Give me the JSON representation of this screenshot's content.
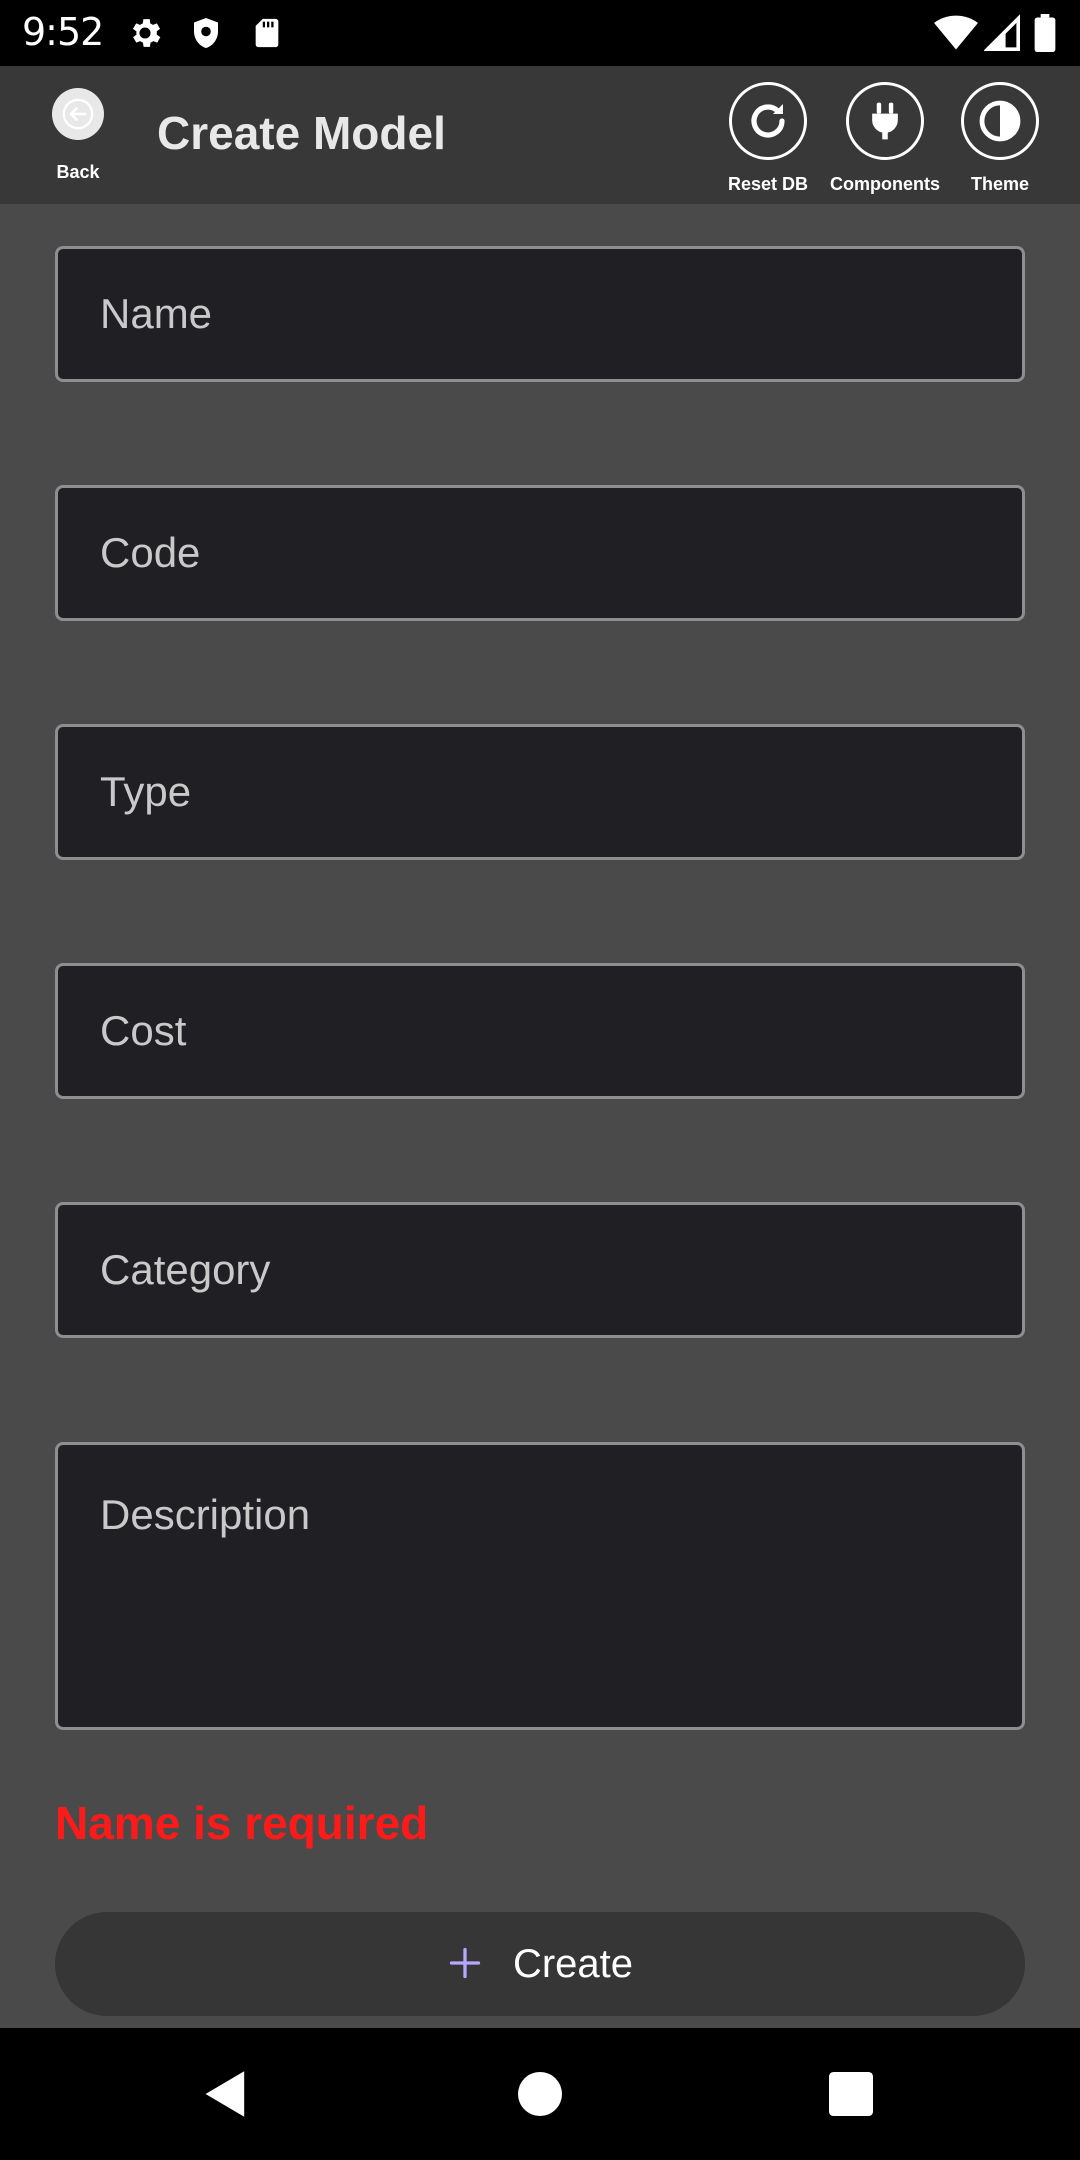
{
  "status_bar": {
    "time": "9:52",
    "icons": [
      "settings-icon",
      "shield-icon",
      "sd-card-icon",
      "wifi-icon",
      "signal-icon",
      "battery-icon"
    ]
  },
  "app_bar": {
    "title": "Create Model",
    "back_label": "Back",
    "actions": [
      {
        "label": "Reset DB",
        "icon": "refresh-icon"
      },
      {
        "label": "Components",
        "icon": "plug-icon"
      },
      {
        "label": "Theme",
        "icon": "contrast-icon"
      }
    ]
  },
  "form": {
    "name": {
      "placeholder": "Name",
      "value": ""
    },
    "code": {
      "placeholder": "Code",
      "value": ""
    },
    "type": {
      "placeholder": "Type",
      "value": ""
    },
    "cost": {
      "placeholder": "Cost",
      "value": ""
    },
    "category": {
      "placeholder": "Category",
      "value": ""
    },
    "description": {
      "placeholder": "Description",
      "value": ""
    },
    "error": "Name is required",
    "create_label": "Create"
  },
  "colors": {
    "background": "#4a4a4a",
    "app_bar": "#383838",
    "field_bg": "#1f1f24",
    "error": "#ff1a1a",
    "accent": "#b9a7ff"
  }
}
